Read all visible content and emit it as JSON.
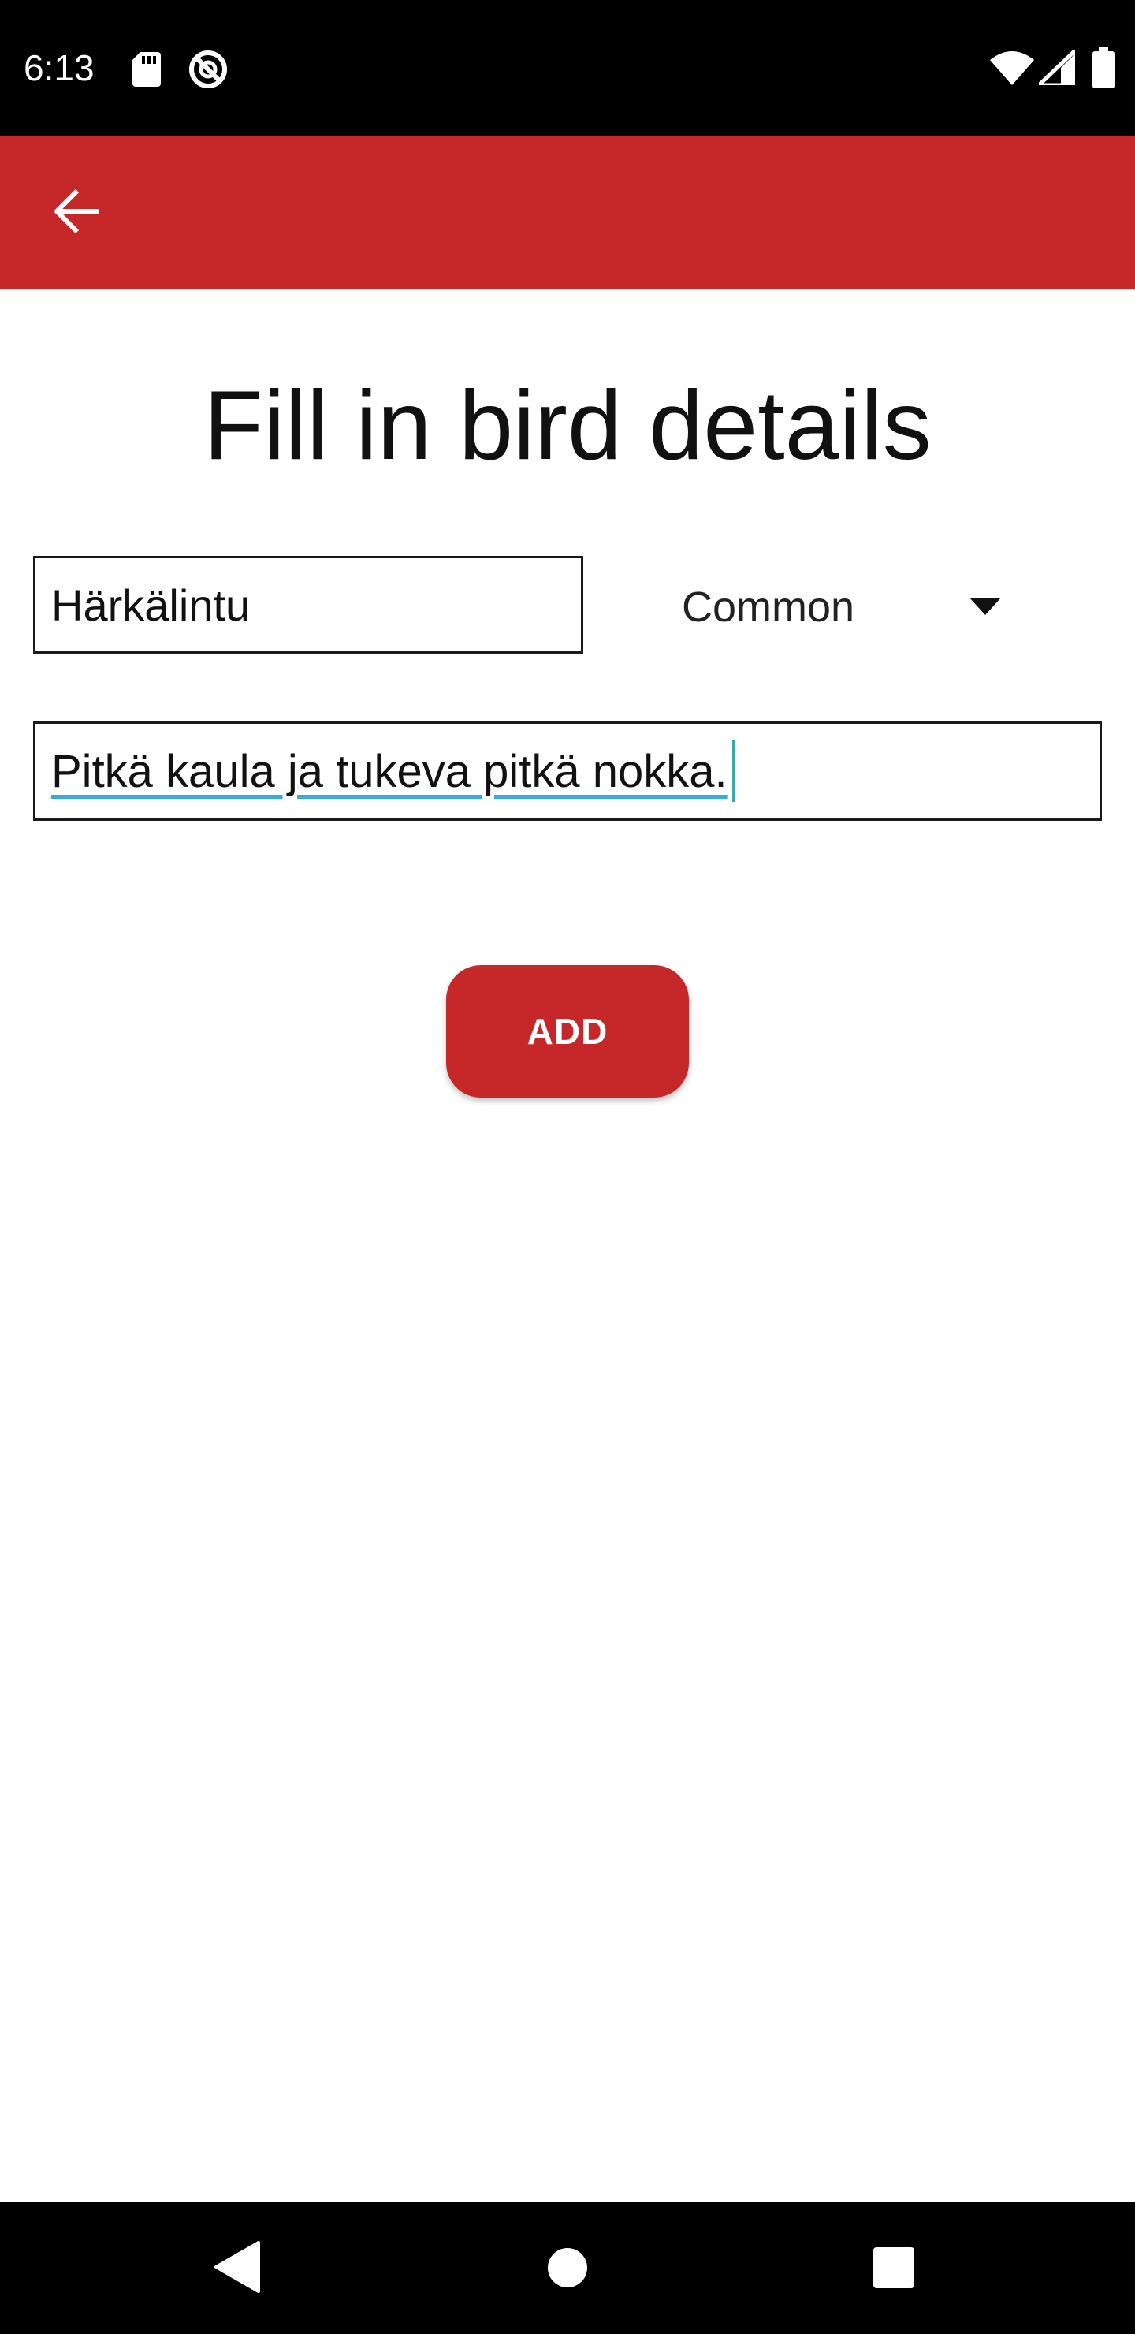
{
  "status_bar": {
    "time": "6:13",
    "icons": [
      "sd-card-icon",
      "do-not-disturb-icon",
      "wifi-icon",
      "cell-signal-icon",
      "battery-icon"
    ]
  },
  "app_bar": {
    "back_icon": "arrow-back-icon",
    "color": "#c6282a"
  },
  "form": {
    "title": "Fill in bird details",
    "name_value": "Härkälintu",
    "rarity_selected": "Common",
    "description_words": [
      "Pitkä",
      "kaula",
      "ja",
      "tukeva",
      "pitkä",
      "nokka"
    ],
    "description_value": "Pitkä kaula ja tukeva pitkä nokka.",
    "add_label": "ADD"
  },
  "nav_bar": {
    "icons": [
      "nav-back-icon",
      "nav-home-icon",
      "nav-recents-icon"
    ]
  }
}
